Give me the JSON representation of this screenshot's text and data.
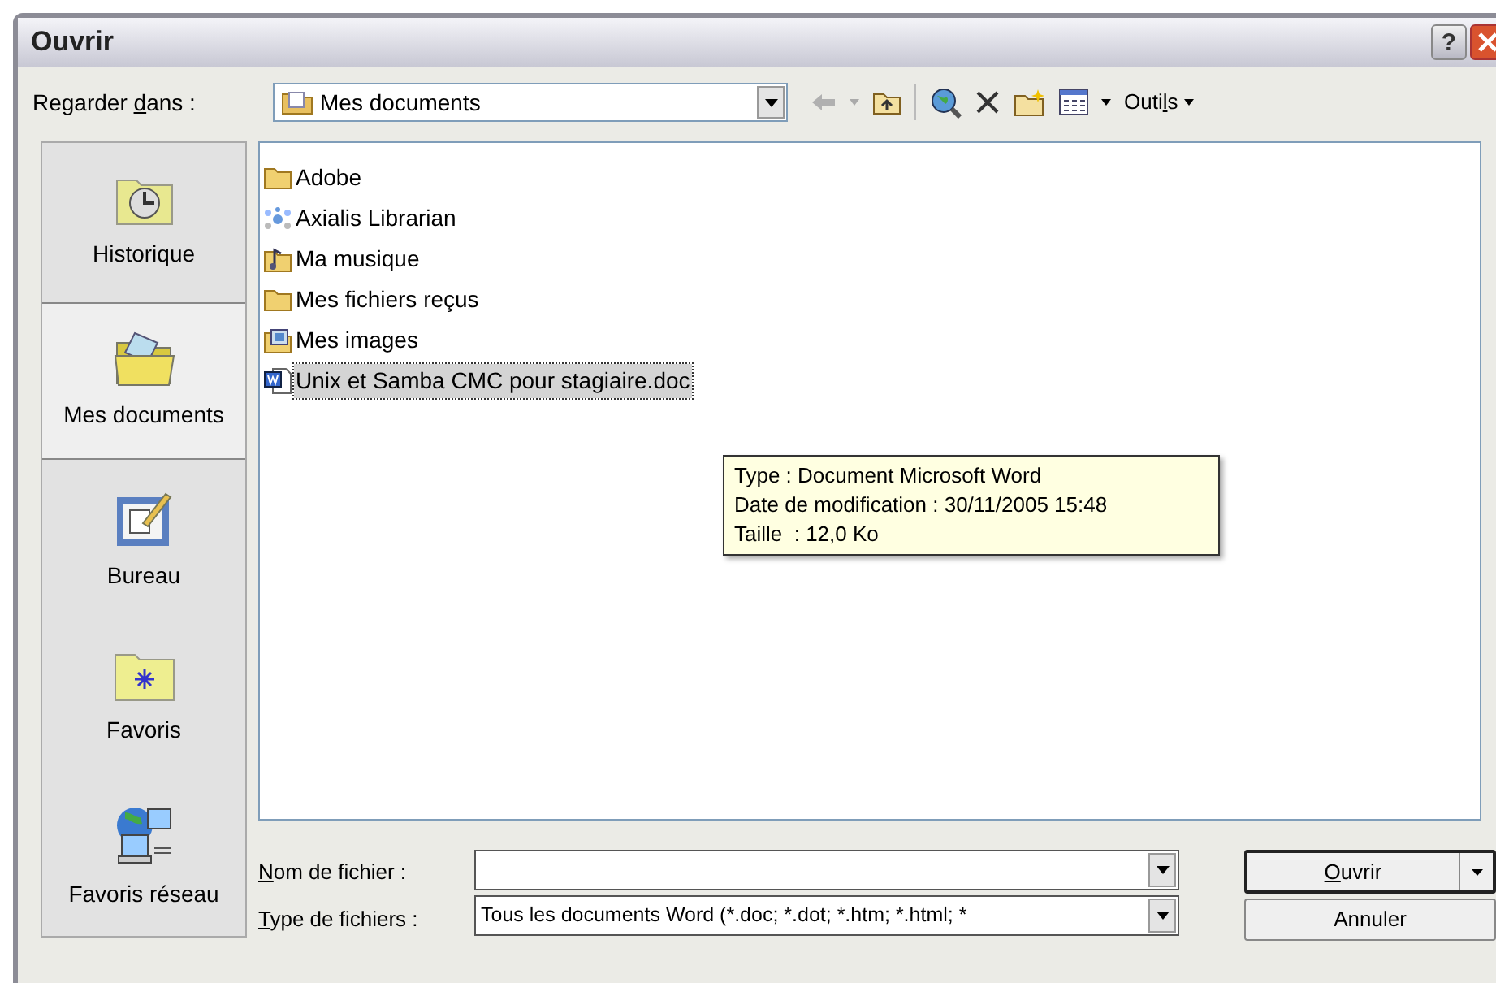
{
  "window": {
    "title": "Ouvrir",
    "help_button": "?"
  },
  "toolbar": {
    "look_in_label_parts": [
      {
        "text": "Regarder ",
        "underlined": false
      },
      {
        "text": "d",
        "underlined": true
      },
      {
        "text": "ans :",
        "underlined": false
      }
    ],
    "location": "Mes documents",
    "back_disabled": true,
    "tools_label_parts": [
      {
        "text": "Outi",
        "underlined": false
      },
      {
        "text": "l",
        "underlined": true
      },
      {
        "text": "s",
        "underlined": false
      }
    ]
  },
  "places": [
    {
      "label": "Historique",
      "kind": "history",
      "selected": false
    },
    {
      "label": "Mes documents",
      "kind": "documents",
      "selected": true
    },
    {
      "label": "Bureau",
      "kind": "desktop",
      "selected": false
    },
    {
      "label": "Favoris",
      "kind": "favorites",
      "selected": false
    },
    {
      "label": "Favoris réseau",
      "kind": "network",
      "selected": false
    }
  ],
  "files": [
    {
      "name": "Adobe",
      "kind": "folder",
      "selected": false
    },
    {
      "name": "Axialis Librarian",
      "kind": "app",
      "selected": false
    },
    {
      "name": "Ma musique",
      "kind": "music",
      "selected": false
    },
    {
      "name": "Mes fichiers reçus",
      "kind": "folder",
      "selected": false
    },
    {
      "name": "Mes images",
      "kind": "images",
      "selected": false
    },
    {
      "name": "Unix et Samba CMC pour stagiaire.doc",
      "kind": "word",
      "selected": true
    }
  ],
  "tooltip": [
    "Type : Document Microsoft Word",
    "Date de modification : 30/11/2005 15:48",
    "Taille  : 12,0 Ko"
  ],
  "file_name": {
    "label_parts": [
      {
        "text": "N",
        "underlined": true
      },
      {
        "text": "om de fichier :",
        "underlined": false
      }
    ]
  },
  "file_type": {
    "label_parts": [
      {
        "text": "T",
        "underlined": true
      },
      {
        "text": "ype de fichiers :",
        "underlined": false
      }
    ],
    "value": "Tous les documents Word (*.doc; *.dot; *.htm; *.html; *"
  },
  "buttons": [
    {
      "label_parts": [
        {
          "text": "O",
          "underlined": true
        },
        {
          "text": "uvrir",
          "underlined": false
        }
      ],
      "kind": "split"
    },
    {
      "label_parts": [
        {
          "text": "Annuler",
          "underlined": false
        }
      ],
      "kind": "plain"
    }
  ]
}
